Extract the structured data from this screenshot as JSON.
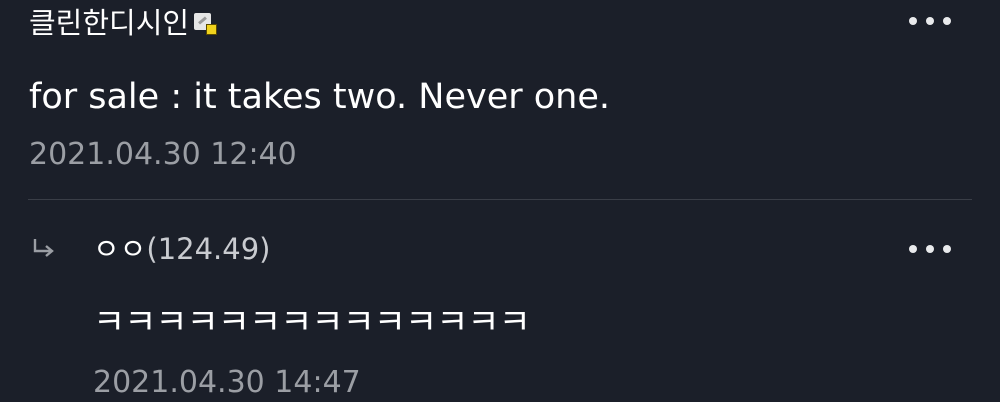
{
  "comments": [
    {
      "author": "클린한디시인",
      "badge_icon": "gallery-badge-icon",
      "text": "for sale : it takes two. Never one.",
      "timestamp": "2021.04.30 12:40",
      "more_icon": "more-dots-icon"
    },
    {
      "author": "ㅇㅇ",
      "ip": "(124.49)",
      "text": "ㅋㅋㅋㅋㅋㅋㅋㅋㅋㅋㅋㅋㅋㅋ",
      "timestamp": "2021.04.30 14:47",
      "reply_icon": "reply-arrow-icon",
      "more_icon": "more-dots-icon"
    }
  ],
  "colors": {
    "background": "#1b1f29",
    "text_primary": "#ffffff",
    "text_secondary": "#9b9ea4",
    "divider": "#3a3e47",
    "badge_accent": "#f0d21c"
  }
}
